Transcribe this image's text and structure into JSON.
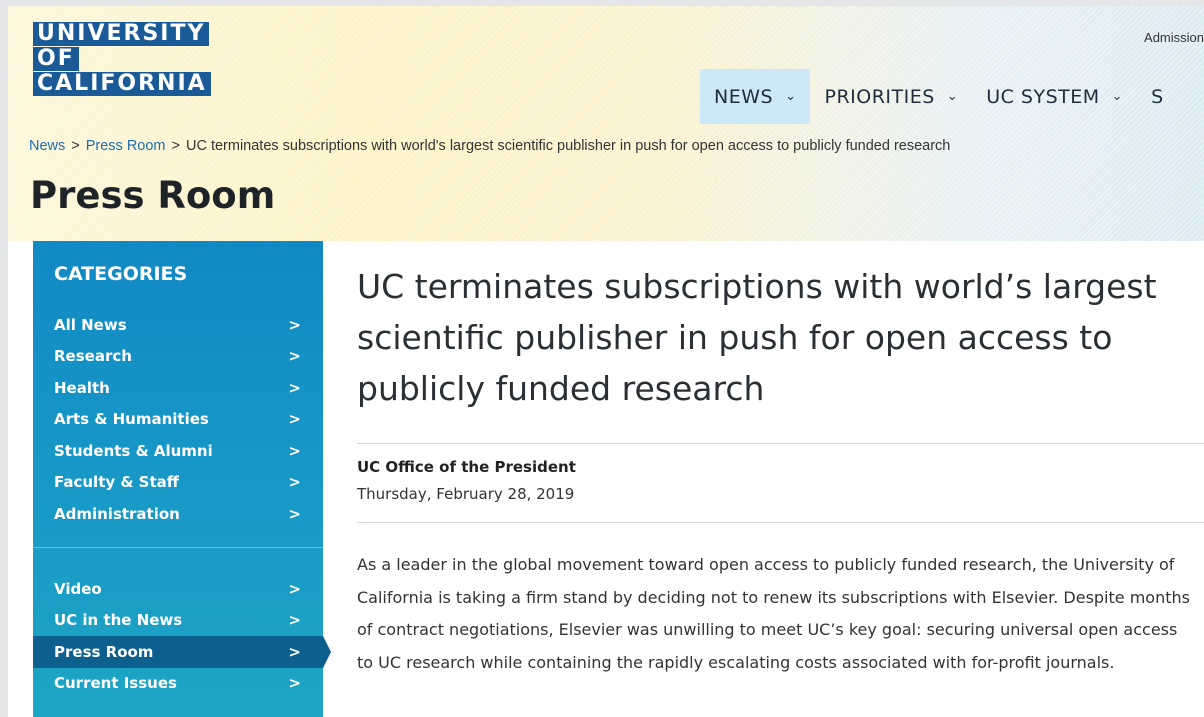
{
  "logo": {
    "lines": [
      "UNIVERSITY",
      "OF",
      "CALIFORNIA"
    ]
  },
  "utility_nav": {
    "admissions": "Admission"
  },
  "nav": {
    "items": [
      {
        "label": "NEWS",
        "active": true
      },
      {
        "label": "PRIORITIES",
        "active": false
      },
      {
        "label": "UC SYSTEM",
        "active": false
      },
      {
        "label": "S",
        "active": false
      }
    ],
    "chevron": "chevron-down-icon"
  },
  "breadcrumb": {
    "items": [
      "News",
      "Press Room"
    ],
    "current": "UC terminates subscriptions with world's largest scientific publisher in push for open access to publicly funded research",
    "separator": ">"
  },
  "page_title": "Press Room",
  "sidebar": {
    "title": "CATEGORIES",
    "primary": [
      "All News",
      "Research",
      "Health",
      "Arts & Humanities",
      "Students & Alumni",
      "Faculty & Staff",
      "Administration"
    ],
    "secondary": [
      "Video",
      "UC in the News",
      "Press Room",
      "Current Issues"
    ],
    "active": "Press Room",
    "arrow": ">"
  },
  "article": {
    "headline": "UC terminates subscriptions with world’s largest scientific publisher in push for open access to publicly funded research",
    "byline": "UC Office of the President",
    "date": "Thursday, February 28, 2019",
    "body": "As a leader in the global movement toward open access to publicly funded research, the University of California is taking a firm stand by deciding not to renew its subscriptions with Elsevier. Despite months of contract negotiations, Elsevier was unwilling to meet UC’s key goal: securing universal open access to UC research while containing the rapidly escalating costs associated with for-profit journals."
  },
  "colors": {
    "logo_blue": "#1a5a96",
    "sidebar_blue": "#1189c4",
    "sidebar_active": "#0d5f8d",
    "nav_active": "#cde8f6",
    "link": "#1a6fb0"
  }
}
